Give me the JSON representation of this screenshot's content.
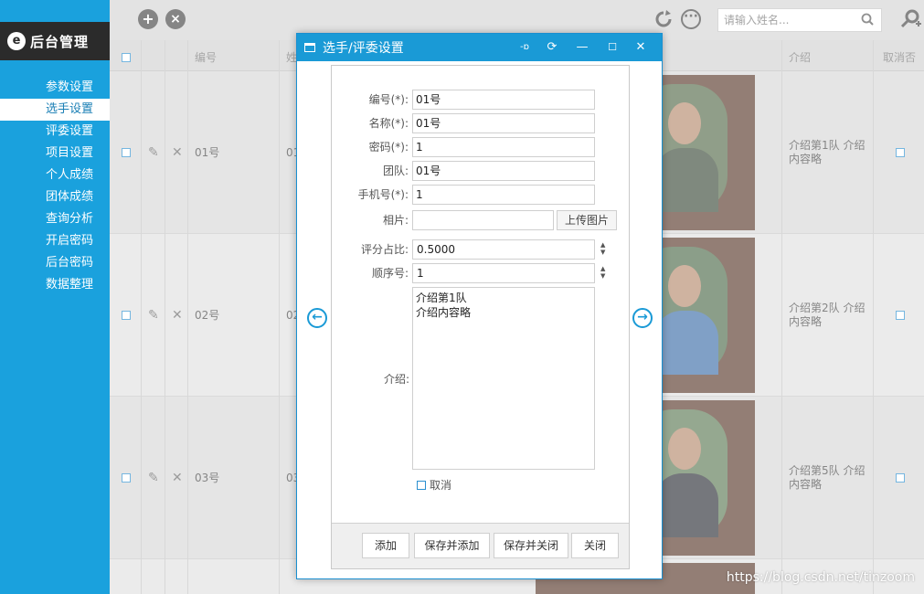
{
  "sidebar": {
    "brand": "后台管理",
    "items": [
      {
        "label": "参数设置"
      },
      {
        "label": "选手设置"
      },
      {
        "label": "评委设置"
      },
      {
        "label": "项目设置"
      },
      {
        "label": "个人成绩"
      },
      {
        "label": "团体成绩"
      },
      {
        "label": "查询分析"
      },
      {
        "label": "开启密码"
      },
      {
        "label": "后台密码"
      },
      {
        "label": "数据整理"
      }
    ]
  },
  "toolbar": {
    "search_placeholder": "请输入姓名..."
  },
  "table": {
    "columns": [
      "编号",
      "姓",
      "介绍",
      "取消否"
    ],
    "rows": [
      {
        "id": "01号",
        "name": "01",
        "intro": "介绍第1队 介绍内容略"
      },
      {
        "id": "02号",
        "name": "02",
        "intro": "介绍第2队 介绍内容略"
      },
      {
        "id": "03号",
        "name": "03",
        "intro": "介绍第5队 介绍内容略"
      }
    ]
  },
  "dialog": {
    "title": "选手/评委设置",
    "fields": {
      "id_label": "编号(*):",
      "id_value": "01号",
      "name_label": "名称(*):",
      "name_value": "01号",
      "password_label": "密码(*):",
      "password_value": "1",
      "team_label": "团队:",
      "team_value": "01号",
      "phone_label": "手机号(*):",
      "phone_value": "1",
      "photo_label": "相片:",
      "photo_value": "",
      "upload_label": "上传图片",
      "ratio_label": "评分占比:",
      "ratio_value": "0.5000",
      "order_label": "顺序号:",
      "order_value": "1",
      "intro_label": "介绍:",
      "intro_value": "介绍第1队\n介绍内容略",
      "cancel_label": "取消"
    },
    "buttons": {
      "add": "添加",
      "save_add": "保存并添加",
      "save_close": "保存并关闭",
      "close": "关闭"
    }
  },
  "watermark": "https://blog.csdn.net/tinzoom",
  "colors": {
    "accent": "#1a9ad6",
    "sidebar": "#1aa1dd",
    "brand_bg": "#2b2b2b"
  }
}
